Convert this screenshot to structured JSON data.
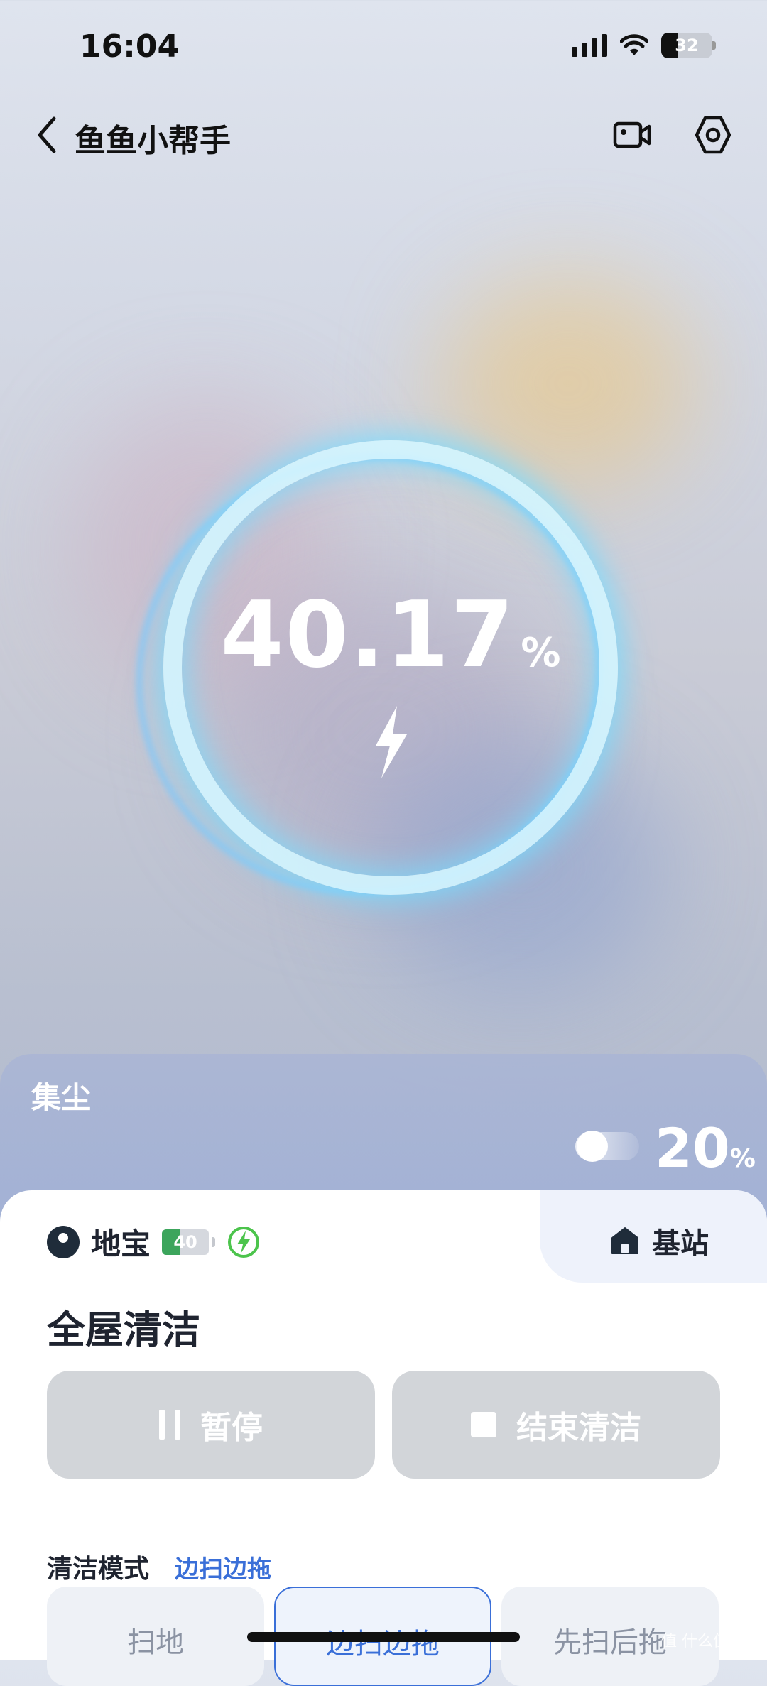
{
  "status_bar": {
    "time": "16:04",
    "battery": "32"
  },
  "header": {
    "title": "鱼鱼小帮手"
  },
  "charge": {
    "value": "40.17",
    "unit": "%"
  },
  "dust": {
    "label": "集尘",
    "value": "20",
    "unit": "%"
  },
  "tabs": {
    "robot": "地宝",
    "robot_battery": "40",
    "base": "基站"
  },
  "clean": {
    "title": "全屋清洁",
    "pause_label": "暂停",
    "end_label": "结束清洁"
  },
  "mode": {
    "label": "清洁模式",
    "current": "边扫边拖",
    "options": [
      "扫地",
      "边扫边拖",
      "先扫后拖"
    ]
  },
  "watermark": "值 什么值得买",
  "colors": {
    "accent": "#3a6fd8",
    "battery_fill": "#3ca55c",
    "charge_green": "#4cc44c"
  }
}
